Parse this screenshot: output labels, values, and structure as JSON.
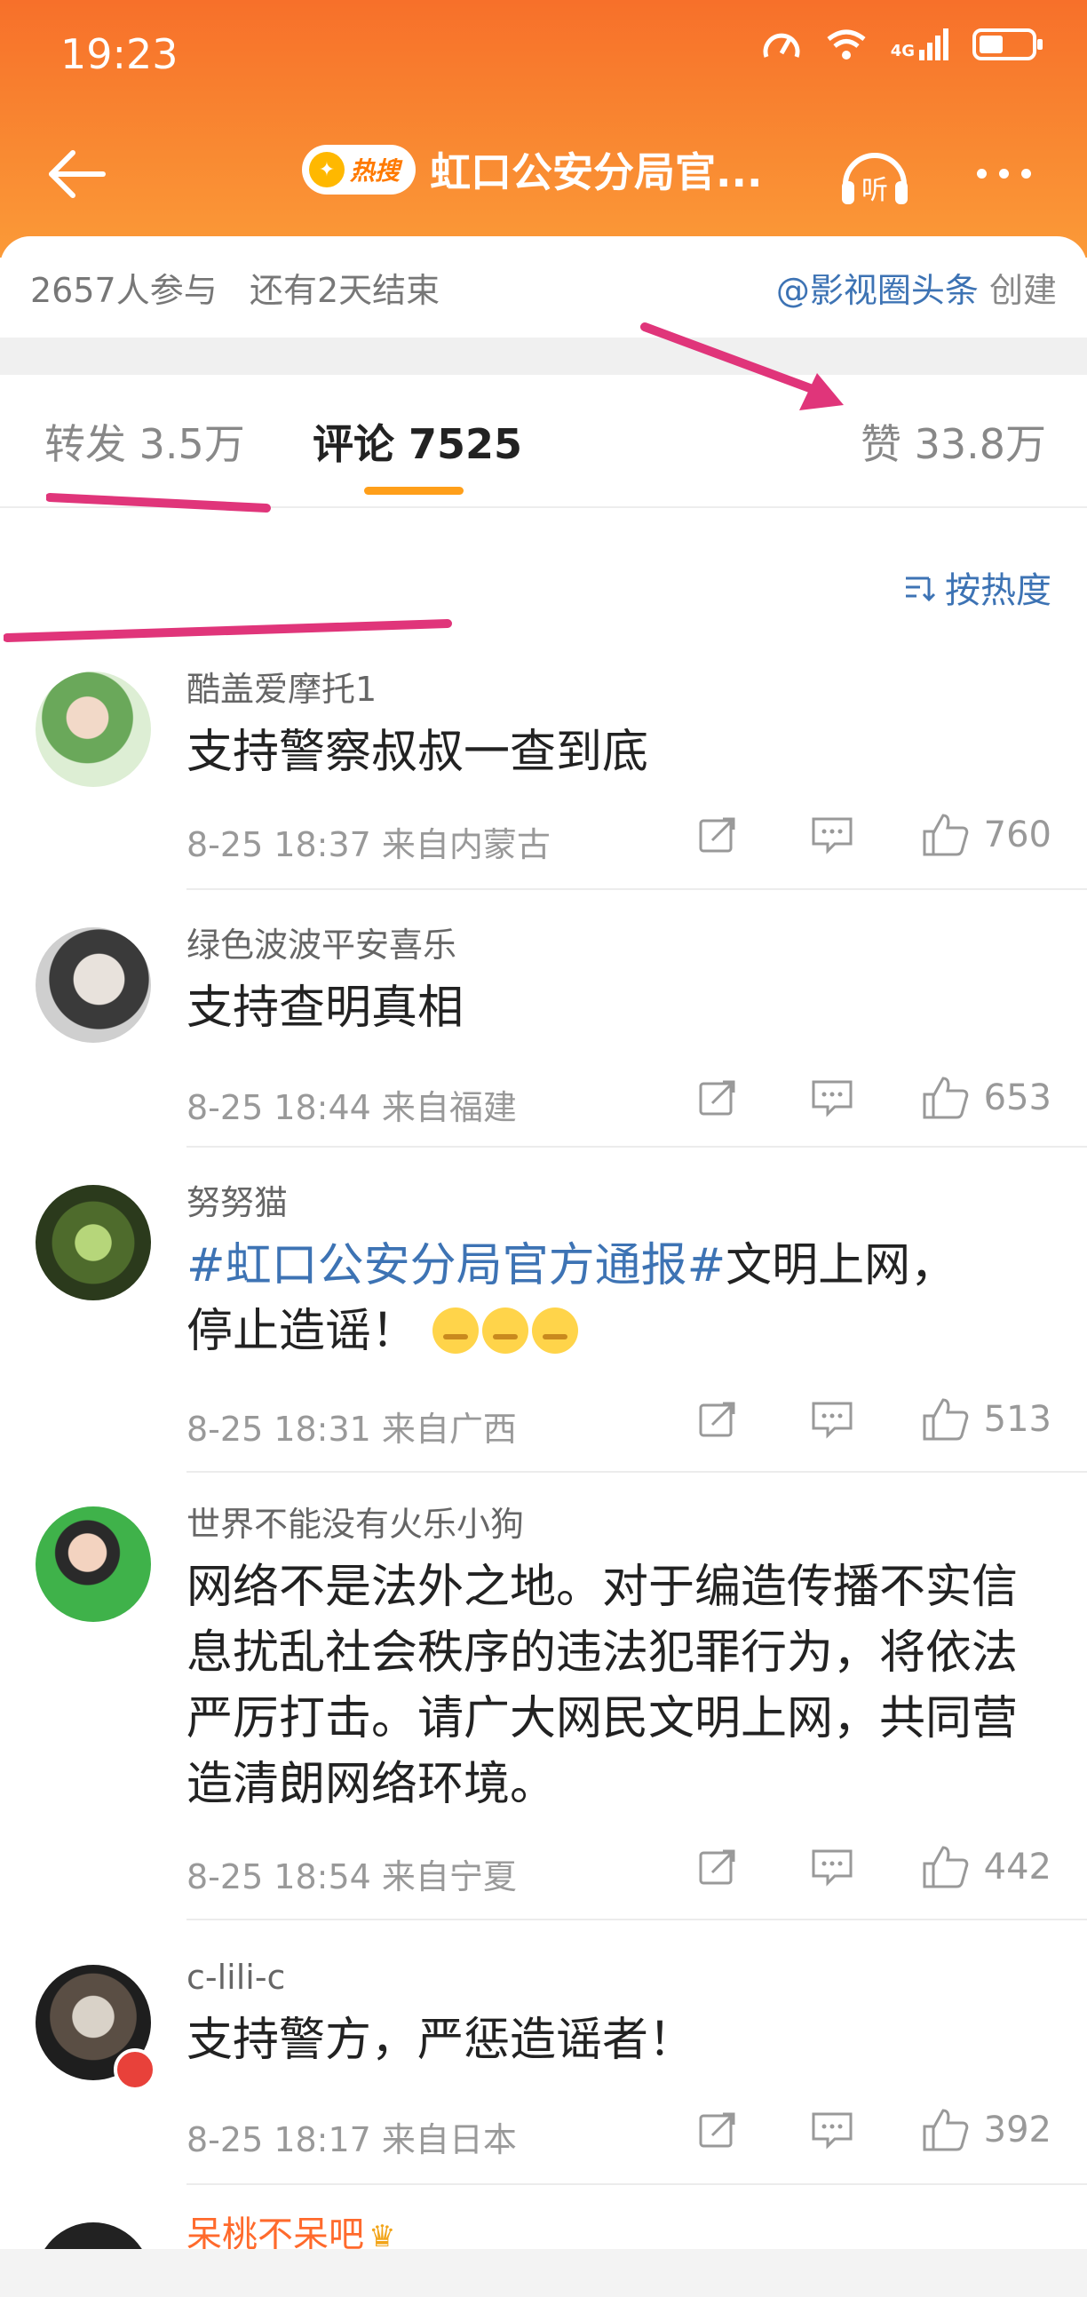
{
  "status_bar": {
    "time": "19:23",
    "network": "4G"
  },
  "nav": {
    "hot_badge": "热搜",
    "title": "虹口公安分局官...",
    "listen_label": "听"
  },
  "topic_info": {
    "participants": "2657人参与",
    "ends": "还有2天结束",
    "creator_mention": "@影视圈头条",
    "creator_suffix": "创建"
  },
  "tabs": {
    "repost": "转发 3.5万",
    "comments": "评论 7525",
    "likes": "赞 33.8万"
  },
  "sort": {
    "label": "按热度"
  },
  "comments": [
    {
      "name": "酷盖爱摩托1",
      "text": "支持警察叔叔一查到底",
      "time_location": "8-25 18:37  来自内蒙古",
      "likes": "760"
    },
    {
      "name": "绿色波波平安喜乐",
      "text": "支持查明真相",
      "time_location": "8-25 18:44  来自福建",
      "likes": "653"
    },
    {
      "name": "努努猫",
      "topic": "#虹口公安分局官方通报#",
      "text_after_topic": "文明上网，",
      "text_line2": "停止造谣！",
      "time_location": "8-25 18:31  来自广西",
      "likes": "513"
    },
    {
      "name": "世界不能没有火乐小狗",
      "text": "网络不是法外之地。对于编造传播不实信息扰乱社会秩序的违法犯罪行为，将依法严厉打击。请广大网民文明上网，共同营造清朗网络环境。",
      "time_location": "8-25 18:54  来自宁夏",
      "likes": "442"
    },
    {
      "name": "c-lili-c",
      "text": "支持警方，严惩造谣者！",
      "time_location": "8-25 18:17  来自日本",
      "likes": "392"
    },
    {
      "name": "呆桃不呆吧"
    }
  ],
  "colors": {
    "header_orange": "#f98a32",
    "link_blue": "#3d73b4",
    "tab_indicator": "#ff9f1a",
    "annotation_pink": "#e0357a"
  },
  "icons": [
    "back-arrow-icon",
    "flame-icon",
    "headphones-icon",
    "more-icon",
    "sort-icon",
    "share-icon",
    "comment-icon",
    "like-icon"
  ]
}
